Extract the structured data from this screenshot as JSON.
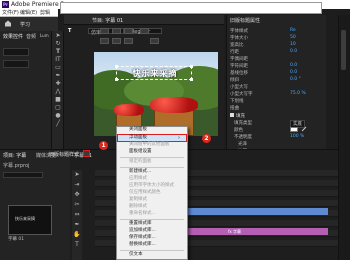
{
  "app": {
    "title": "Adobe Premiere Pr",
    "logo": "Pr"
  },
  "menu": [
    "文件(F)",
    "编辑(E)",
    "剪辑"
  ],
  "workspace": {
    "tab": "学习"
  },
  "left_panel": {
    "tabs": [
      "效果控件",
      "音频",
      "Lum"
    ]
  },
  "monitor": {
    "title": "节目: 字幕 01",
    "row1": [
      "T",
      "仿宋",
      "Regular"
    ],
    "caption": "快乐来采摘"
  },
  "properties": {
    "title": "旧版标题属性",
    "rows": [
      {
        "label": "字体样式",
        "value": "Re"
      },
      {
        "label": "字体大小",
        "value": "50"
      },
      {
        "label": "宽高比",
        "value": "10"
      },
      {
        "label": "行距",
        "value": "0.0"
      },
      {
        "label": "字偶间距",
        "value": ""
      },
      {
        "label": "字符间距",
        "value": "0.0"
      },
      {
        "label": "基线位移",
        "value": "0.0"
      },
      {
        "label": "倾斜",
        "value": "0.0 °"
      },
      {
        "label": "小型大写",
        "value": ""
      },
      {
        "label": "小型大写字",
        "value": "75.0 %"
      },
      {
        "label": "下划线",
        "value": ""
      },
      {
        "label": "扭曲",
        "value": ""
      }
    ],
    "fill_section": "填充",
    "fill_rows": [
      {
        "label": "填充类型",
        "value": "实底"
      },
      {
        "label": "颜色",
        "value": ""
      },
      {
        "label": "不透明度",
        "value": "100 %"
      },
      {
        "label": "光泽",
        "value": ""
      },
      {
        "label": "纹理",
        "value": ""
      }
    ],
    "stroke_section": "描边",
    "stroke_rows": [
      {
        "label": "内描边",
        "value": "添加"
      },
      {
        "label": "外描边",
        "value": "添加"
      }
    ]
  },
  "project": {
    "tabs": [
      "项目: 字幕",
      "媒体浏览"
    ],
    "path": "字幕.prproj",
    "thumb_text": "快乐来采摘",
    "thumb_label": "字幕 01"
  },
  "timeline": {
    "header": "字幕 01",
    "clip_label": "fx 字幕"
  },
  "panel": {
    "tab_label": "旧版标题样式"
  },
  "context_menu": {
    "items": [
      {
        "label": "关闭面板",
        "disabled": false
      },
      {
        "label": "浮动面板",
        "disabled": false,
        "highlighted": true
      },
      {
        "label": "关闭组中的其他面板",
        "disabled": true
      },
      {
        "label": "面板组设置",
        "disabled": false
      },
      {
        "label": "锁定的面板",
        "disabled": true
      },
      {
        "label": "新建样式...",
        "disabled": false
      },
      {
        "label": "应用样式",
        "disabled": true
      },
      {
        "label": "应用带字体大小的样式",
        "disabled": true
      },
      {
        "label": "仅应用样式颜色",
        "disabled": true
      },
      {
        "label": "复制样式",
        "disabled": true
      },
      {
        "label": "删除样式",
        "disabled": true
      },
      {
        "label": "重命名样式...",
        "disabled": true
      },
      {
        "label": "重置样式库",
        "disabled": false
      },
      {
        "label": "追加样式库...",
        "disabled": false
      },
      {
        "label": "保存样式库...",
        "disabled": false
      },
      {
        "label": "替换样式库...",
        "disabled": false
      },
      {
        "label": "仅文本",
        "disabled": false
      }
    ]
  },
  "badges": [
    "1",
    "2"
  ],
  "colors": {
    "highlight_border": "#e01b1b",
    "badge": "#e0261b",
    "accent": "#4aa8ff",
    "clip": "#b45fb4"
  }
}
